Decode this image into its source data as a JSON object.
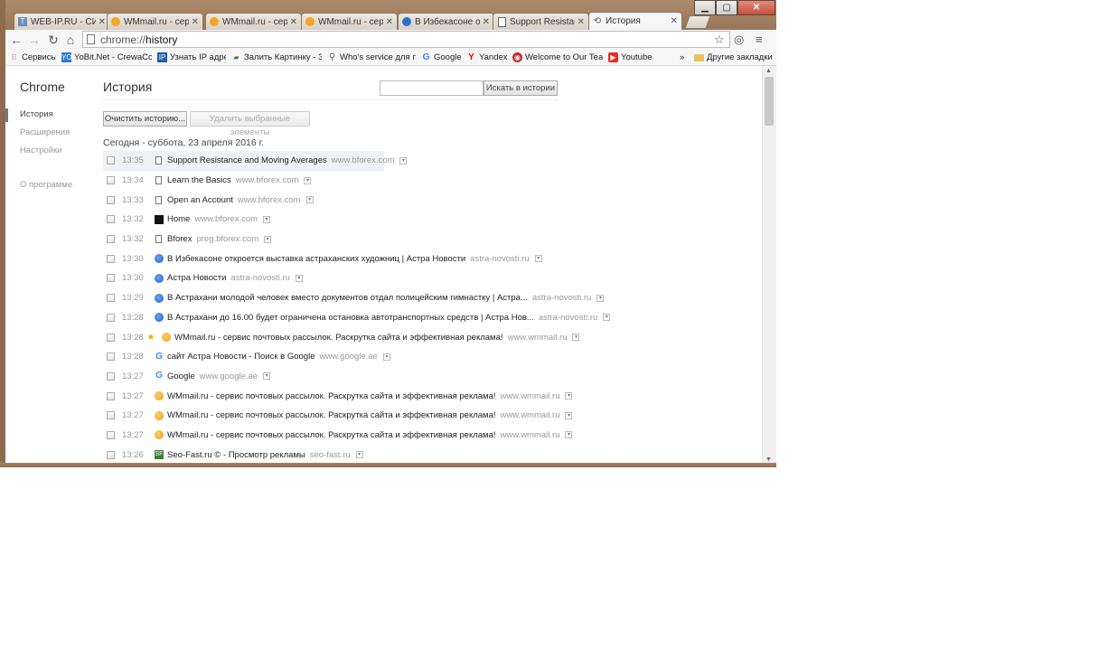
{
  "tabs": [
    {
      "title": "WEB-IP.RU - СИСТ",
      "icon": "wp"
    },
    {
      "title": "WMmail.ru - серв",
      "icon": "mail"
    },
    {
      "title": "WMmail.ru - серв",
      "icon": "mail"
    },
    {
      "title": "WMmail.ru - серв",
      "icon": "mail"
    },
    {
      "title": "В Избекасоне отк",
      "icon": "globe"
    },
    {
      "title": "Support Resistanc",
      "icon": "doc"
    },
    {
      "title": "История",
      "icon": "history",
      "active": true
    }
  ],
  "toolbar": {
    "url_scheme": "chrome://",
    "url_host": "history"
  },
  "bookmarks": [
    {
      "label": "Сервисы",
      "icon": "apps"
    },
    {
      "label": "YoBit.Net - CrewaCom",
      "icon": "yo"
    },
    {
      "label": "Узнать IP адрес",
      "icon": "ip"
    },
    {
      "label": "Залить Картинку - За",
      "icon": "img"
    },
    {
      "label": "Who's service для пр",
      "icon": "search"
    },
    {
      "label": "Google",
      "icon": "google"
    },
    {
      "label": "Yandex",
      "icon": "yandex"
    },
    {
      "label": "Welcome to Our Team",
      "icon": "team"
    },
    {
      "label": "Youtube",
      "icon": "youtube"
    }
  ],
  "bookmarks_overflow": "»",
  "other_bookmarks": "Другие закладки",
  "sidebar": {
    "brand": "Chrome",
    "items": [
      {
        "label": "История",
        "selected": true
      },
      {
        "label": "Расширения"
      },
      {
        "label": "Настройки"
      }
    ],
    "about": "О программе"
  },
  "main": {
    "title": "История",
    "search_button": "Искать в истории",
    "clear_button": "Очистить историю...",
    "remove_button": "Удалить выбранные элементы",
    "day_header": "Сегодня - суббота, 23 апреля 2016 г."
  },
  "history": [
    {
      "time": "13:35",
      "icon": "doc",
      "title": "Support Resistance and Moving Averages",
      "domain": "www.bforex.com"
    },
    {
      "time": "13:34",
      "icon": "doc",
      "title": "Learn the Basics",
      "domain": "www.bforex.com"
    },
    {
      "time": "13:33",
      "icon": "doc",
      "title": "Open an Account",
      "domain": "www.bforex.com"
    },
    {
      "time": "13:32",
      "icon": "black",
      "title": "Home",
      "domain": "www.bforex.com"
    },
    {
      "time": "13:32",
      "icon": "doc",
      "title": "Bforex",
      "domain": "preg.bforex.com"
    },
    {
      "time": "13:30",
      "icon": "globe",
      "title": "В Избекасоне откроется выставка астраханских художниц | Астра Новости",
      "domain": "astra-novosti.ru"
    },
    {
      "time": "13:30",
      "icon": "globe",
      "title": "Астра Новости",
      "domain": "astra-novosti.ru"
    },
    {
      "time": "13:29",
      "icon": "globe",
      "title": "В Астрахани молодой человек вместо документов отдал полицейским гимнастку | Астра...",
      "domain": "astra-novosti.ru"
    },
    {
      "time": "13:28",
      "icon": "globe",
      "title": "В Астрахани до 16.00 будет ограничена остановка автотранспортных средств | Астра Нов...",
      "domain": "astra-novosti.ru"
    },
    {
      "time": "13:28",
      "icon": "mail",
      "title": "WMmail.ru - сервис почтовых рассылок. Раскрутка сайта и эффективная реклама!",
      "domain": "www.wmmail.ru",
      "starred": true
    },
    {
      "time": "13:28",
      "icon": "google",
      "title": "сайт Астра Новости - Поиск в Google",
      "domain": "www.google.ae"
    },
    {
      "time": "13:27",
      "icon": "google",
      "title": "Google",
      "domain": "www.google.ae"
    },
    {
      "time": "13:27",
      "icon": "mail",
      "title": "WMmail.ru - сервис почтовых рассылок. Раскрутка сайта и эффективная реклама!",
      "domain": "www.wmmail.ru"
    },
    {
      "time": "13:27",
      "icon": "mail",
      "title": "WMmail.ru - сервис почтовых рассылок. Раскрутка сайта и эффективная реклама!",
      "domain": "www.wmmail.ru"
    },
    {
      "time": "13:27",
      "icon": "mail",
      "title": "WMmail.ru - сервис почтовых рассылок. Раскрутка сайта и эффективная реклама!",
      "domain": "www.wmmail.ru"
    },
    {
      "time": "13:26",
      "icon": "sf",
      "title": "Seo-Fast.ru © - Просмотр рекламы",
      "domain": "seo-fast.ru"
    }
  ]
}
